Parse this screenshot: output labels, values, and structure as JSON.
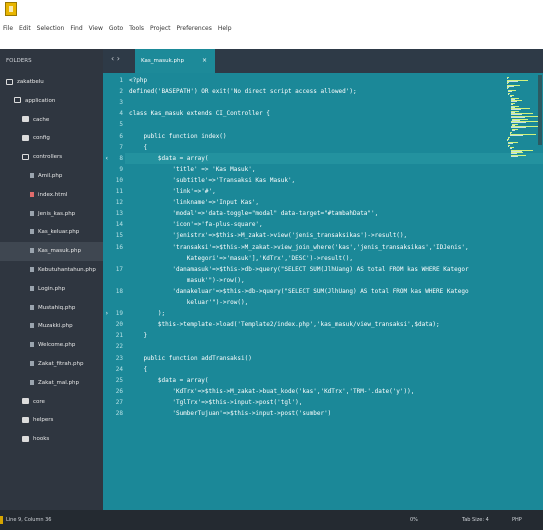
{
  "window": {
    "menu": [
      "File",
      "Edit",
      "Selection",
      "Find",
      "View",
      "Goto",
      "Tools",
      "Project",
      "Preferences",
      "Help"
    ]
  },
  "sidebar": {
    "header": "FOLDERS",
    "items": [
      {
        "label": "zakatbelu",
        "type": "folder-open",
        "indent": 0
      },
      {
        "label": "application",
        "type": "folder-open",
        "indent": 1
      },
      {
        "label": "cache",
        "type": "folder",
        "indent": 2
      },
      {
        "label": "config",
        "type": "folder",
        "indent": 2
      },
      {
        "label": "controllers",
        "type": "folder-open",
        "indent": 2
      },
      {
        "label": "Amil.php",
        "type": "file",
        "indent": 3
      },
      {
        "label": "index.html",
        "type": "file-red",
        "indent": 3
      },
      {
        "label": "Jenis_kas.php",
        "type": "file",
        "indent": 3
      },
      {
        "label": "Kas_keluar.php",
        "type": "file",
        "indent": 3
      },
      {
        "label": "Kas_masuk.php",
        "type": "file",
        "indent": 3,
        "selected": true
      },
      {
        "label": "Kebutuhantahun.php",
        "type": "file",
        "indent": 3
      },
      {
        "label": "Login.php",
        "type": "file",
        "indent": 3
      },
      {
        "label": "Mustahiq.php",
        "type": "file",
        "indent": 3
      },
      {
        "label": "Muzakki.php",
        "type": "file",
        "indent": 3
      },
      {
        "label": "Welcome.php",
        "type": "file",
        "indent": 3
      },
      {
        "label": "Zakat_fitrah.php",
        "type": "file",
        "indent": 3
      },
      {
        "label": "Zakat_mal.php",
        "type": "file",
        "indent": 3
      },
      {
        "label": "core",
        "type": "folder",
        "indent": 2
      },
      {
        "label": "helpers",
        "type": "folder",
        "indent": 2
      },
      {
        "label": "hooks",
        "type": "folder",
        "indent": 2
      }
    ]
  },
  "editor": {
    "nav": "‹  ›",
    "tab_label": "Kas_masuk.php",
    "tab_close": "×",
    "lines": [
      {
        "n": "1",
        "text": "<?php"
      },
      {
        "n": "2",
        "text": "defined('BASEPATH') OR exit('No direct script access allowed');"
      },
      {
        "n": "3",
        "text": ""
      },
      {
        "n": "4",
        "text": "class Kas_masuk extends CI_Controller {"
      },
      {
        "n": "5",
        "text": ""
      },
      {
        "n": "6",
        "text": "    public function index()"
      },
      {
        "n": "7",
        "text": "    {"
      },
      {
        "n": "8",
        "text": "        $data = array(",
        "fold": "‹",
        "current": true
      },
      {
        "n": "9",
        "text": "            'title' => 'Kas Masuk',"
      },
      {
        "n": "10",
        "text": "            'subtitle'=>'Transaksi Kas Masuk',"
      },
      {
        "n": "11",
        "text": "            'link'=>'#',"
      },
      {
        "n": "12",
        "text": "            'linkname'=>'Input Kas',"
      },
      {
        "n": "13",
        "text": "            'modal'=>'data-toggle=\"modal\" data-target=\"#tambahData\"',"
      },
      {
        "n": "14",
        "text": "            'icon'=>'fa-plus-square',"
      },
      {
        "n": "15",
        "text": "            'jenistrx'=>$this->M_zakat->view('jenis_transaksikas')->result(),"
      },
      {
        "n": "16",
        "text": "            'transaksi'=>$this->M_zakat->view_join_where('kas','jenis_transaksikas','IDJenis',['"
      },
      {
        "n": "",
        "text": "                Kategori'=>'masuk'],'KdTrx','DESC')->result(),"
      },
      {
        "n": "17",
        "text": "            'danamasuk'=>$this->db->query(\"SELECT SUM(JlhUang) AS total FROM kas WHERE Kategori = '"
      },
      {
        "n": "",
        "text": "                masuk'\")->row(),"
      },
      {
        "n": "18",
        "text": "            'danakeluar'=>$this->db->query(\"SELECT SUM(JlhUang) AS total FROM kas WHERE Kategori = '"
      },
      {
        "n": "",
        "text": "                keluar'\")->row(),"
      },
      {
        "n": "19",
        "text": "        );",
        "fold": "›"
      },
      {
        "n": "20",
        "text": "        $this->template->load('Template2/index.php','kas_masuk/view_transaksi',$data);"
      },
      {
        "n": "21",
        "text": "    }"
      },
      {
        "n": "22",
        "text": ""
      },
      {
        "n": "23",
        "text": "    public function addTransaksi()"
      },
      {
        "n": "24",
        "text": "    {"
      },
      {
        "n": "25",
        "text": "        $data = array("
      },
      {
        "n": "26",
        "text": "            'KdTrx'=>$this->M_zakat->buat_kode('kas','KdTrx','TRM-'.date('y')),"
      },
      {
        "n": "27",
        "text": "            'TglTrx'=>$this->input->post('tgl'),"
      },
      {
        "n": "28",
        "text": "            'SumberTujuan'=>$this->input->post('sumber')"
      }
    ]
  },
  "status": {
    "position": "Line 9, Column 36",
    "percent": "0%",
    "tab_size": "Tab Size: 4",
    "syntax": "PHP"
  },
  "colors": {
    "editor_bg": "#1b8898",
    "sidebar_bg": "#2f3640",
    "tab_active": "#1d8a99"
  }
}
